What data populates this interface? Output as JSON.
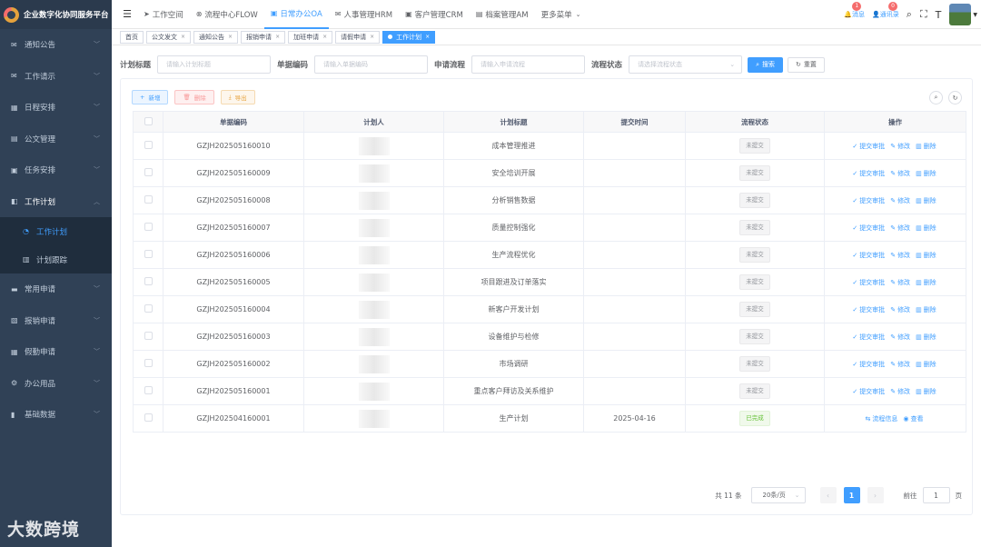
{
  "app": {
    "title": "企业数字化协同服务平台"
  },
  "sidebar": {
    "items": [
      {
        "label": "通知公告",
        "icon": "mail-icon"
      },
      {
        "label": "工作请示",
        "icon": "mail-icon"
      },
      {
        "label": "日程安排",
        "icon": "calendar-icon"
      },
      {
        "label": "公文管理",
        "icon": "document-icon"
      },
      {
        "label": "任务安排",
        "icon": "task-icon"
      },
      {
        "label": "工作计划",
        "icon": "plan-icon",
        "sub": [
          {
            "label": "工作计划",
            "icon": "dashboard-icon",
            "active": true
          },
          {
            "label": "计划跟踪",
            "icon": "track-icon"
          }
        ]
      },
      {
        "label": "常用申请",
        "icon": "apply-icon"
      },
      {
        "label": "报销申请",
        "icon": "reimburse-icon"
      },
      {
        "label": "假勤申请",
        "icon": "leave-icon"
      },
      {
        "label": "办公用品",
        "icon": "supplies-icon"
      },
      {
        "label": "基础数据",
        "icon": "chart-icon"
      }
    ]
  },
  "watermark": "大数跨境",
  "topnav": {
    "tabs": [
      "工作空间",
      "流程中心FLOW",
      "日常办公OA",
      "人事管理HRM",
      "客户管理CRM",
      "档案管理AM",
      "更多菜单"
    ],
    "active_tab": 2,
    "messages_label": "消息",
    "messages_count": "1",
    "contacts_label": "通讯录",
    "contacts_count": "0"
  },
  "tags": [
    {
      "label": "首页",
      "closable": false
    },
    {
      "label": "公文发文",
      "closable": true
    },
    {
      "label": "通知公告",
      "closable": true
    },
    {
      "label": "报销申请",
      "closable": true
    },
    {
      "label": "加班申请",
      "closable": true
    },
    {
      "label": "请假申请",
      "closable": true
    },
    {
      "label": "工作计划",
      "closable": true,
      "active": true
    }
  ],
  "search": {
    "plan_title_label": "计划标题",
    "plan_title_placeholder": "请输入计划标题",
    "doc_no_label": "单据编码",
    "doc_no_placeholder": "请输入单据编码",
    "flow_label": "申请流程",
    "flow_placeholder": "请输入申请流程",
    "status_label": "流程状态",
    "status_placeholder": "请选择流程状态",
    "search_button": "搜索",
    "reset_button": "重置"
  },
  "toolbar": {
    "add": "新增",
    "delete": "删除",
    "export": "导出"
  },
  "table": {
    "headers": [
      "单据编码",
      "计划人",
      "计划标题",
      "提交时间",
      "流程状态",
      "操作"
    ],
    "rows": [
      {
        "code": "GZJH202505160010",
        "title": "成本管理推进",
        "time": "",
        "status": "未提交"
      },
      {
        "code": "GZJH202505160009",
        "title": "安全培训开展",
        "time": "",
        "status": "未提交"
      },
      {
        "code": "GZJH202505160008",
        "title": "分析销售数据",
        "time": "",
        "status": "未提交"
      },
      {
        "code": "GZJH202505160007",
        "title": "质量控制强化",
        "time": "",
        "status": "未提交"
      },
      {
        "code": "GZJH202505160006",
        "title": "生产流程优化",
        "time": "",
        "status": "未提交"
      },
      {
        "code": "GZJH202505160005",
        "title": "项目跟进及订单落实",
        "time": "",
        "status": "未提交"
      },
      {
        "code": "GZJH202505160004",
        "title": "新客户开发计划",
        "time": "",
        "status": "未提交"
      },
      {
        "code": "GZJH202505160003",
        "title": "设备维护与检修",
        "time": "",
        "status": "未提交"
      },
      {
        "code": "GZJH202505160002",
        "title": "市场调研",
        "time": "",
        "status": "未提交"
      },
      {
        "code": "GZJH202505160001",
        "title": "重点客户拜访及关系维护",
        "time": "",
        "status": "未提交"
      },
      {
        "code": "GZJH202504160001",
        "title": "生产计划",
        "time": "2025-04-16",
        "status": "已完成"
      }
    ],
    "op_submit": "提交审批",
    "op_edit": "修改",
    "op_delete": "删除",
    "op_flow": "流程信息",
    "op_view": "查看"
  },
  "pagination": {
    "total": "共 11 条",
    "page_size": "20条/页",
    "current": "1",
    "goto_label": "前往",
    "goto_value": "1",
    "page_suffix": "页"
  },
  "colors": {
    "primary": "#409eff",
    "sidebar": "#304156",
    "danger": "#f56c6c",
    "success": "#67c23a"
  }
}
